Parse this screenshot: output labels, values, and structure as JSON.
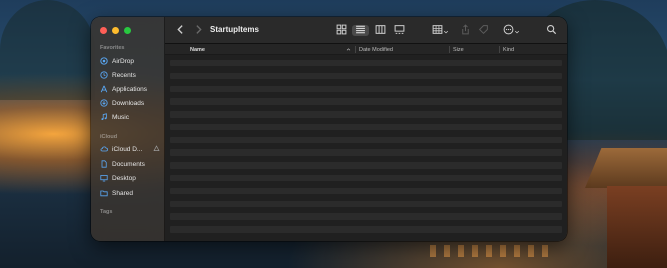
{
  "window": {
    "title": "StartupItems"
  },
  "sidebar": {
    "favorites_heading": "Favorites",
    "favorites": [
      {
        "label": "AirDrop",
        "icon": "airdrop-icon"
      },
      {
        "label": "Recents",
        "icon": "clock-icon"
      },
      {
        "label": "Applications",
        "icon": "applications-icon"
      },
      {
        "label": "Downloads",
        "icon": "download-icon"
      },
      {
        "label": "Music",
        "icon": "music-icon"
      }
    ],
    "icloud_heading": "iCloud",
    "icloud": [
      {
        "label": "iCloud D...",
        "icon": "icloud-icon"
      },
      {
        "label": "Documents",
        "icon": "document-icon"
      },
      {
        "label": "Desktop",
        "icon": "desktop-icon"
      },
      {
        "label": "Shared",
        "icon": "shared-folder-icon"
      }
    ],
    "tags_heading": "Tags"
  },
  "columns": {
    "name": "Name",
    "date_modified": "Date Modified",
    "size": "Size",
    "kind": "Kind"
  },
  "colors": {
    "accent": "#5aa8f5",
    "close": "#ff5f57",
    "minimize": "#febc2e",
    "maximize": "#28c840"
  }
}
